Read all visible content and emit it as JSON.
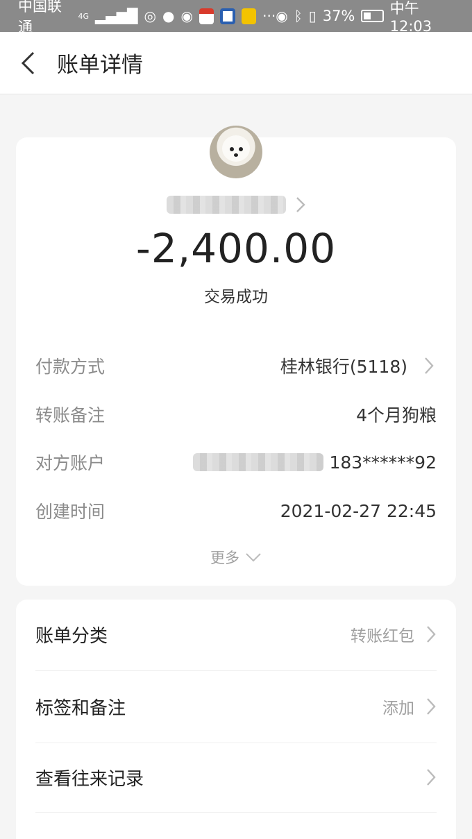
{
  "status_bar": {
    "carrier": "中国联通",
    "network": "4G",
    "battery": "37%",
    "time": "中午12:03",
    "icons": [
      "signal-icon",
      "hotspot-icon",
      "message-icon",
      "wechat-icon",
      "app-icon",
      "app-icon",
      "app-icon",
      "more-dots-icon",
      "eye-icon",
      "bluetooth-icon",
      "vibrate-icon",
      "battery-icon"
    ]
  },
  "header": {
    "title": "账单详情",
    "back_icon": "chevron-left-icon"
  },
  "transaction": {
    "avatar_icon": "dog-avatar",
    "amount": "-2,400.00",
    "status": "交易成功",
    "details": [
      {
        "label": "付款方式",
        "value": "桂林银行(5118)",
        "has_arrow": true
      },
      {
        "label": "转账备注",
        "value": "4个月狗粮",
        "has_arrow": false
      },
      {
        "label": "对方账户",
        "value": "183******92",
        "has_arrow": false
      },
      {
        "label": "创建时间",
        "value": "2021-02-27 22:45",
        "has_arrow": false
      }
    ],
    "more_label": "更多"
  },
  "actions": [
    {
      "label": "账单分类",
      "value": "转账红包"
    },
    {
      "label": "标签和备注",
      "value": "添加"
    },
    {
      "label": "查看往来记录",
      "value": ""
    }
  ],
  "colors": {
    "page_bg": "#f5f5f5",
    "card_bg": "#ffffff",
    "status_bar_bg": "#8a8a8a",
    "label_gray": "#8b8b8b",
    "text_dark": "#222222"
  }
}
